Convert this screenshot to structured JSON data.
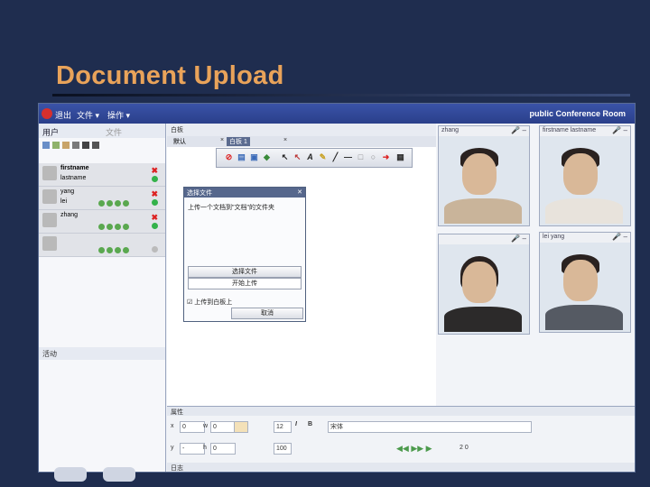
{
  "slide": {
    "title": "Document Upload"
  },
  "app": {
    "menu": {
      "exit": "退出",
      "file": "文件 ▾",
      "actions": "操作 ▾"
    },
    "room_name": "public Conference Room"
  },
  "users_panel": {
    "tab_users": "用户",
    "tab_files": "文件",
    "users": [
      {
        "name": "firstname",
        "sub": "lastname"
      },
      {
        "name": "yang",
        "sub": "lei"
      },
      {
        "name": "zhang",
        "sub": ""
      },
      {
        "name": "",
        "sub": ""
      }
    ],
    "footer_label": "活动"
  },
  "whiteboard": {
    "header": "白板",
    "tab_default": "默认",
    "tab_active": "白板 1"
  },
  "upload_dialog": {
    "title": "选择文件",
    "description": "上传一个文档到\"文档\"的文件夹",
    "choose_button": "选择文件",
    "upload_button": "开始上传",
    "checkbox_label": "上传到白板上",
    "cancel_button": "取消"
  },
  "videos": [
    {
      "name": "zhang",
      "shirt": "#c9b49a"
    },
    {
      "name": "firstname lastname",
      "shirt": "#e8e3dc"
    },
    {
      "name": "",
      "shirt": "#2c2a2a"
    },
    {
      "name": "lei yang",
      "shirt": "#555a63"
    }
  ],
  "properties": {
    "header": "属性",
    "x_label": "x",
    "x_value": "0",
    "w_label": "w",
    "w_value": "0",
    "y_label": "y",
    "y_value": "-",
    "h_label": "h",
    "h_value": "0",
    "font_size": "12",
    "zoom": "100",
    "font_name": "宋体",
    "page_count": "2 0",
    "footer": "日志"
  },
  "colors": {
    "title": "#e9a35a",
    "background": "#1f2d4f",
    "accent": "#2a3f8a"
  }
}
